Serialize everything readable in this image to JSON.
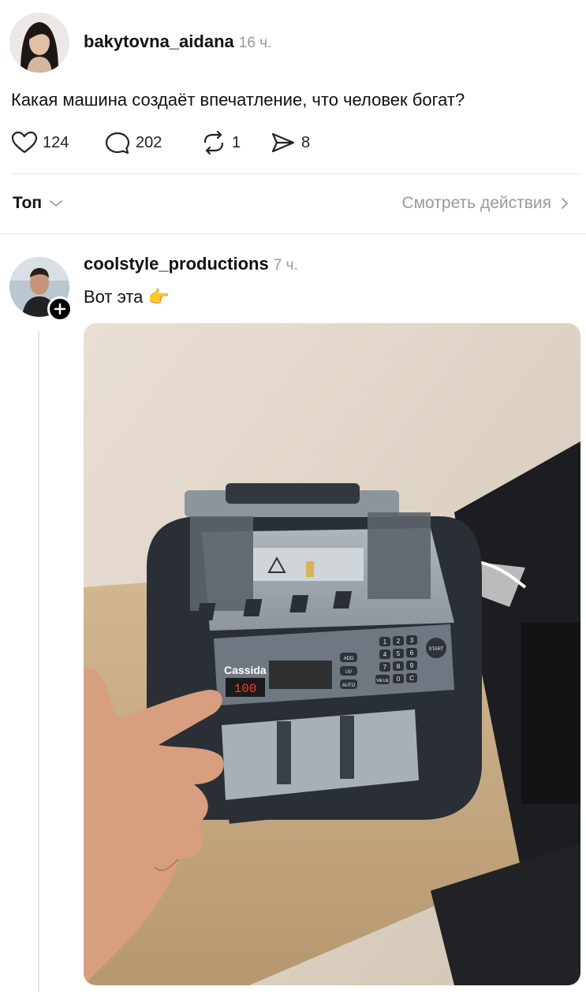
{
  "post": {
    "username": "bakytovna_aidana",
    "time": "16 ч.",
    "text": "Какая машина создаёт впечатление, что человек богат?",
    "likes": "124",
    "comments": "202",
    "reposts": "1",
    "shares": "8"
  },
  "sort": {
    "label": "Топ",
    "view_activity": "Смотреть действия"
  },
  "reply": {
    "username": "coolstyle_productions",
    "time": "7 ч.",
    "text": "Вот эта 👉",
    "image": {
      "brand": "Cassida",
      "display": "100",
      "keypad": [
        "1",
        "2",
        "3",
        "4",
        "5",
        "6",
        "7",
        "8",
        "9",
        "0",
        "C"
      ],
      "side_buttons": [
        "ADD",
        "UV",
        "AUTO"
      ],
      "start": "START",
      "val": "VALUE"
    }
  },
  "colors": {
    "text": "#111111",
    "muted": "#999999",
    "divider": "#e5e5e5"
  }
}
